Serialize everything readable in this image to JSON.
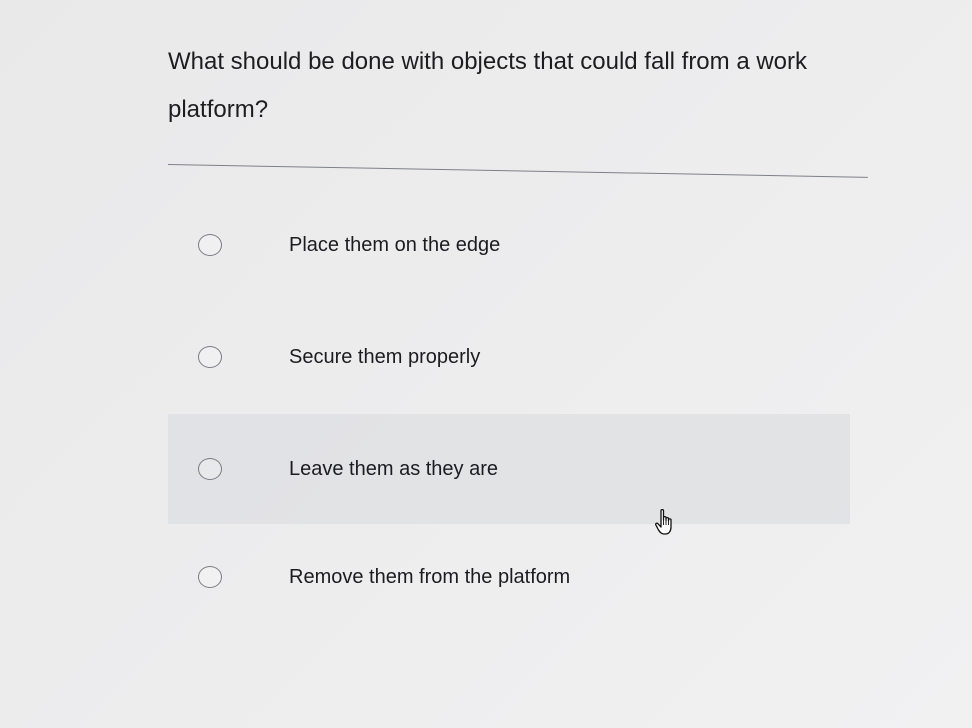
{
  "question": {
    "text": "What should be done with objects that could fall from a work platform?"
  },
  "options": [
    {
      "label": "Place them on the edge",
      "selected": false
    },
    {
      "label": "Secure them properly",
      "selected": false
    },
    {
      "label": "Leave them as they are",
      "selected": false,
      "hovered": true
    },
    {
      "label": "Remove them from the platform",
      "selected": false
    }
  ],
  "cursor": {
    "icon": "hand-pointer-icon"
  }
}
